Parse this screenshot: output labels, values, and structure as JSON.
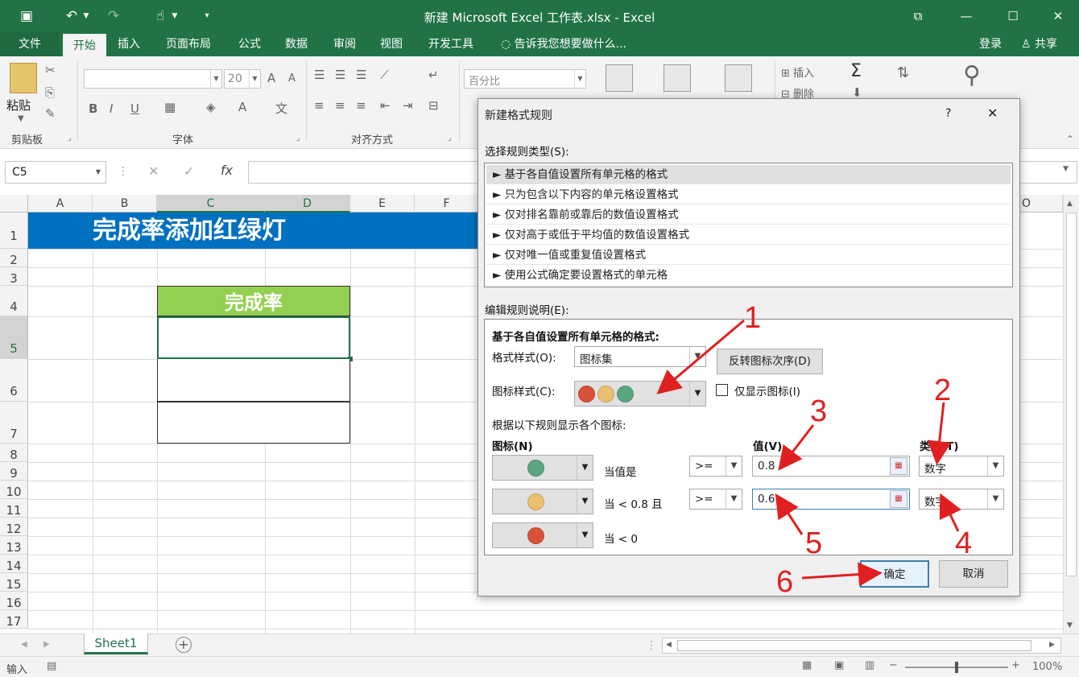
{
  "window": {
    "title": "新建 Microsoft Excel 工作表.xlsx - Excel"
  },
  "tabs": {
    "file": "文件",
    "home": "开始",
    "insert": "插入",
    "layout": "页面布局",
    "formulas": "公式",
    "data": "数据",
    "review": "审阅",
    "view": "视图",
    "developer": "开发工具",
    "tellme": "告诉我您想要做什么...",
    "login": "登录",
    "share": "共享"
  },
  "ribbon": {
    "paste": "粘贴",
    "clipboard": "剪贴板",
    "font_group": "字体",
    "align_group": "对齐方式",
    "font_size": "20",
    "number_format": "百分比",
    "insert_cells": "插入",
    "delete_cells": "删除",
    "bold": "B",
    "italic": "I",
    "underline": "U",
    "grow": "A",
    "shrink": "A",
    "font_color": "A"
  },
  "formula_bar": {
    "name_box": "C5",
    "fx": "fx"
  },
  "grid": {
    "columns": [
      "A",
      "B",
      "C",
      "D",
      "E",
      "F",
      "O"
    ],
    "rows": [
      "1",
      "2",
      "3",
      "4",
      "5",
      "6",
      "7",
      "8",
      "9",
      "10",
      "11",
      "12",
      "13",
      "14",
      "15",
      "16",
      "17"
    ],
    "title_text": "完成率添加红绿灯",
    "header_text": "完成率",
    "title_bg": "#0070c0",
    "header_bg": "#92d050"
  },
  "sheet_tabs": [
    "Sheet1"
  ],
  "status": {
    "mode": "输入",
    "zoom": "100%"
  },
  "dialog": {
    "title": "新建格式规则",
    "help": "?",
    "select_type_label": "选择规则类型(S):",
    "rule_types": [
      "► 基于各自值设置所有单元格的格式",
      "► 只为包含以下内容的单元格设置格式",
      "► 仅对排名靠前或靠后的数值设置格式",
      "► 仅对高于或低于平均值的数值设置格式",
      "► 仅对唯一值或重复值设置格式",
      "► 使用公式确定要设置格式的单元格"
    ],
    "edit_desc_label": "编辑规则说明(E):",
    "desc_heading": "基于各自值设置所有单元格的格式:",
    "format_style_label": "格式样式(O):",
    "format_style_value": "图标集",
    "reverse_btn": "反转图标次序(D)",
    "icon_style_label": "图标样式(C):",
    "show_icon_only": "仅显示图标(I)",
    "rules_label": "根据以下规则显示各个图标:",
    "col_icon": "图标(N)",
    "col_value": "值(V)",
    "col_type": "类型(T)",
    "rows": [
      {
        "color": "#5ba67f",
        "cond": "当值是",
        "op": ">=",
        "value": "0.8",
        "type": "数字"
      },
      {
        "color": "#eabf70",
        "cond": "当 < 0.8 且",
        "op": ">=",
        "value": "0.6",
        "type": "数字"
      },
      {
        "color": "#d9513a",
        "cond": "当 < 0",
        "op": "",
        "value": "",
        "type": ""
      }
    ],
    "ok": "确定",
    "cancel": "取消"
  },
  "annotations": [
    "1",
    "2",
    "3",
    "4",
    "5",
    "6"
  ]
}
